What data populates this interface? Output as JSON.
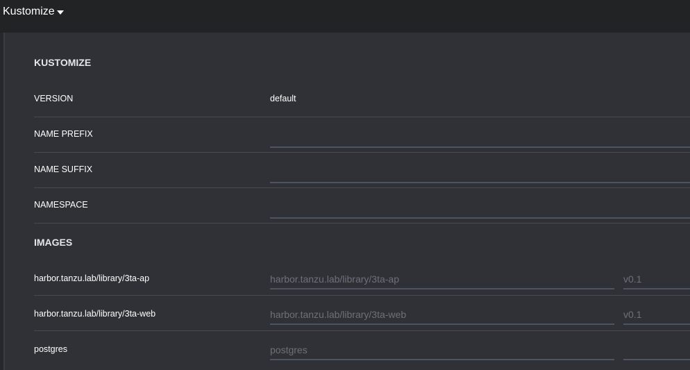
{
  "header": {
    "title": "Kustomize"
  },
  "kustomize": {
    "section_title": "KUSTOMIZE",
    "version_label": "VERSION",
    "version_value": "default",
    "name_prefix_label": "NAME PREFIX",
    "name_prefix_value": "",
    "name_suffix_label": "NAME SUFFIX",
    "name_suffix_value": "",
    "namespace_label": "NAMESPACE",
    "namespace_value": ""
  },
  "images": {
    "section_title": "IMAGES",
    "rows": [
      {
        "label": "harbor.tanzu.lab/library/3ta-ap",
        "image_placeholder": "harbor.tanzu.lab/library/3ta-ap",
        "tag_placeholder": "v0.1"
      },
      {
        "label": "harbor.tanzu.lab/library/3ta-web",
        "image_placeholder": "harbor.tanzu.lab/library/3ta-web",
        "tag_placeholder": "v0.1"
      },
      {
        "label": "postgres",
        "image_placeholder": "postgres",
        "tag_placeholder": ""
      }
    ]
  }
}
